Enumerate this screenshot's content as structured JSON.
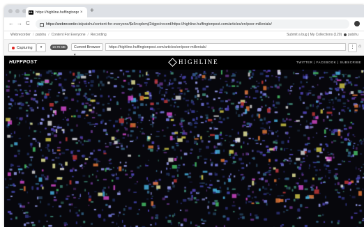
{
  "tab": {
    "favicon": "HL",
    "title": "https://highline.huffingtonpo",
    "close": "×",
    "new_tab": "+"
  },
  "address_bar": {
    "back": "←",
    "forward": "→",
    "reload": "C",
    "url_host": "https://webrecorder.io",
    "url_path": "/patshu/content-for-everyone/$s5rcqdxmj/2dgpx/record/https://highline.huffingtonpost.com/articles/en/poor-millenials/"
  },
  "webrecorder_nav": {
    "crumbs": [
      "Webrecorder",
      "patshu",
      "Content For Everyone",
      "Recording"
    ],
    "right": "Submit a bug  |  My Collections (120)",
    "user": "patshu"
  },
  "capture_bar": {
    "capture_label": "Capturing",
    "size_badge": "10.79 MB",
    "browser_select": "Current Browser ▾",
    "url": "https://highline.huffingtonpost.com/articles/en/poor-millenials/",
    "menu": "⋮",
    "home": "⌂"
  },
  "site": {
    "left_logo": "HUFFPOST",
    "center_logo": "HIGHLINE",
    "social": "TWITTER  |  FACEBOOK  |  SUBSCRIBE"
  },
  "colors": {
    "site_bg": "#07070c",
    "record_red": "#e0201c"
  }
}
